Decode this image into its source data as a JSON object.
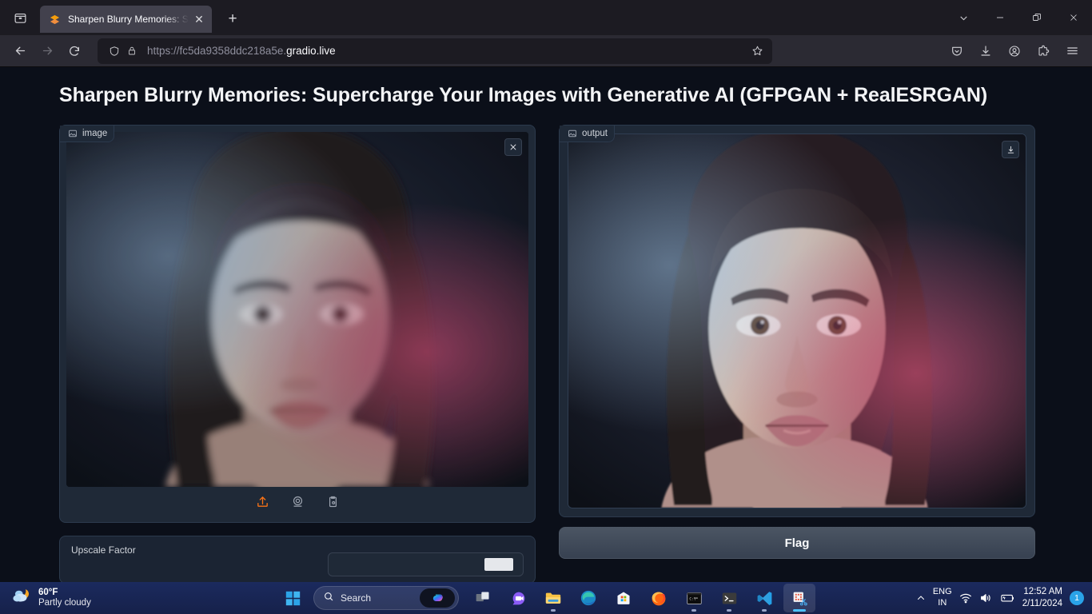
{
  "browser": {
    "tab": {
      "title": "Sharpen Blurry Memories: Supe",
      "favicon_name": "gradio-favicon",
      "close_label": "✕"
    },
    "newtab_label": "+",
    "window_controls": {
      "list_tabs": "⌄",
      "minimize": "—",
      "restore": "❐",
      "close": "✕"
    },
    "nav": {
      "back": "←",
      "forward": "→",
      "reload": "↻"
    },
    "url": {
      "scheme": "https://fc5da9358ddc218a5e.",
      "domain": "gradio.live",
      "full": "https://fc5da9358ddc218a5e.gradio.live"
    },
    "toolbar_icons": [
      "pocket-icon",
      "downloads-icon",
      "account-icon",
      "extensions-icon",
      "app-menu-icon"
    ]
  },
  "page": {
    "title": "Sharpen Blurry Memories: Supercharge Your Images with Generative AI (GFPGAN + RealESRGAN)",
    "input_panel": {
      "label": "image",
      "clear_icon": "close-icon",
      "tools": [
        "upload-icon",
        "webcam-icon",
        "paste-clipboard-icon"
      ]
    },
    "output_panel": {
      "label": "output",
      "download_icon": "download-icon",
      "flag_button": "Flag"
    },
    "settings_panel": {
      "label": "Upscale Factor"
    }
  },
  "taskbar": {
    "weather": {
      "temperature": "60°F",
      "condition": "Partly cloudy"
    },
    "start_label": "start-button",
    "search": {
      "placeholder": "Search",
      "copilot": "copilot-icon"
    },
    "apps": [
      {
        "name": "task-view-icon",
        "active": false,
        "running": false
      },
      {
        "name": "teams-chat-icon",
        "active": false,
        "running": false
      },
      {
        "name": "file-explorer-icon",
        "active": false,
        "running": true
      },
      {
        "name": "microsoft-edge-icon",
        "active": false,
        "running": false
      },
      {
        "name": "microsoft-store-icon",
        "active": false,
        "running": false
      },
      {
        "name": "firefox-icon",
        "active": false,
        "running": true
      },
      {
        "name": "command-prompt-icon",
        "active": false,
        "running": true
      },
      {
        "name": "windows-terminal-icon",
        "active": false,
        "running": true
      },
      {
        "name": "vs-code-icon",
        "active": false,
        "running": true
      },
      {
        "name": "snipping-tool-icon",
        "active": true,
        "running": true
      }
    ],
    "tray": {
      "show_hidden": "⌃",
      "language_top": "ENG",
      "language_bottom": "IN",
      "network": "wifi-icon",
      "volume": "volume-icon",
      "battery": "battery-charging-icon",
      "time": "12:52 AM",
      "date": "2/11/2024",
      "notification_count": "1"
    }
  }
}
